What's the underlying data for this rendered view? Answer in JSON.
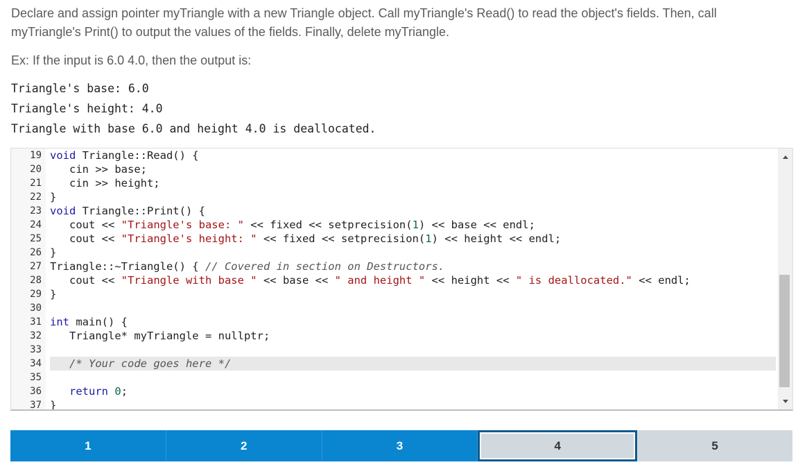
{
  "instructions": {
    "paragraph1": "Declare and assign pointer myTriangle with a new Triangle object. Call myTriangle's Read() to read the object's fields. Then, call myTriangle's Print() to output the values of the fields. Finally, delete myTriangle.",
    "paragraph2": "Ex: If the input is 6.0 4.0, then the output is:"
  },
  "example_output": [
    "Triangle's base: 6.0",
    "Triangle's height: 4.0",
    "Triangle with base 6.0 and height 4.0 is deallocated."
  ],
  "editor": {
    "line_numbers": [
      "19",
      "20",
      "21",
      "22",
      "23",
      "24",
      "25",
      "26",
      "27",
      "28",
      "29",
      "30",
      "31",
      "32",
      "33",
      "34",
      "35",
      "36",
      "37"
    ],
    "active_line": "34"
  },
  "progress_steps": {
    "items": [
      "1",
      "2",
      "3",
      "4",
      "5"
    ],
    "current": "4"
  },
  "colors": {
    "step_done": "#0a86d1",
    "step_pending": "#d1d8de",
    "step_current_border": "#0c5a8f"
  },
  "icons": {
    "scroll_up": "triangle-up-icon",
    "scroll_down": "triangle-down-icon"
  }
}
